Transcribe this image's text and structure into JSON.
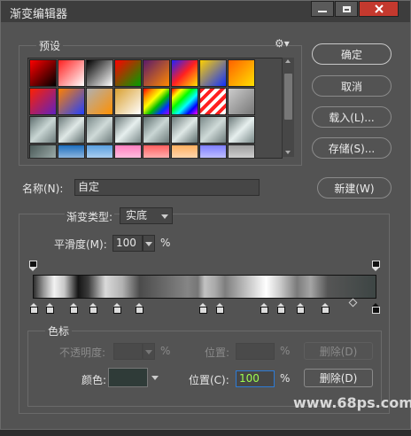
{
  "window": {
    "title": "渐变编辑器"
  },
  "presets": {
    "label": "预设",
    "gear_icon": "gear-icon",
    "swatch_rows": [
      [
        "linear-gradient(135deg,#ff0000,#000000)",
        "linear-gradient(135deg,#ff2020,#ffffff)",
        "linear-gradient(135deg,#000000,#ffffff)",
        "linear-gradient(135deg,#ff0000,#00a000)",
        "linear-gradient(135deg,#5a1a6a,#ff8800)",
        "linear-gradient(135deg,#2020ff,#ff2020,#ffe000)",
        "linear-gradient(135deg,#ffd000,#1030ff)",
        "linear-gradient(135deg,#ff6000,#ffe000)"
      ],
      [
        "linear-gradient(135deg,#ff2000,#6020c0)",
        "linear-gradient(135deg,#ff8000,#2040ff)",
        "linear-gradient(135deg,#b0b0b0,#ff9000)",
        "linear-gradient(135deg,#d9a030,#ffffff)",
        "linear-gradient(135deg,#ff0000,#ff9000,#ffff00,#00c000,#0030ff,#a000ff)",
        "linear-gradient(135deg,#ff0000,#ffff00,#00ff00,#00ffff,#0000ff,#ff00ff)",
        "repeating-linear-gradient(135deg,#ff2020 0 4px,#ffffff 4px 8px)",
        "linear-gradient(135deg,#cccccc,#777777)"
      ],
      [
        "linear-gradient(135deg,#5f6f6f,#c9d6d4,#6d7b7b)",
        "linear-gradient(135deg,#6d7b7b,#dfe8e6,#5f6f6f)",
        "linear-gradient(135deg,#7b8a8a,#cfdad8,#6d7b7b)",
        "linear-gradient(135deg,#6d7b7b,#e6efee,#7b8a8a)",
        "linear-gradient(135deg,#5f6f6f,#c9d6d4,#6d7b7b)",
        "linear-gradient(135deg,#6d7b7b,#dfe8e6,#5f6f6f)",
        "linear-gradient(135deg,#7b8a8a,#cfdad8,#6d7b7b)",
        "linear-gradient(135deg,#6d7b7b,#e6efee,#7b8a8a)"
      ],
      [
        "linear-gradient(135deg,#4a5a58,#b8c6c4)",
        "linear-gradient(180deg,#1e6fbf,#ffffff)",
        "linear-gradient(180deg,#5aa0e0,#ffffff)",
        "linear-gradient(180deg,#ff80c0,#ffffff)",
        "linear-gradient(180deg,#ff6060,#ffffff)",
        "linear-gradient(180deg,#ffb060,#ffffff)",
        "linear-gradient(180deg,#8080ff,#ffffff)",
        "linear-gradient(180deg,#a0a0a0,#ffffff)"
      ]
    ]
  },
  "buttons": {
    "ok": "确定",
    "cancel": "取消",
    "load": "载入(L)...",
    "save": "存储(S)...",
    "new": "新建(W)"
  },
  "name": {
    "label": "名称(N):",
    "value": "自定"
  },
  "gradient_type": {
    "label": "渐变类型:",
    "value": "实底"
  },
  "smoothness": {
    "label": "平滑度(M):",
    "value": "100",
    "unit": "%"
  },
  "color_stops_section": {
    "title": "色标",
    "opacity_label": "不透明度:",
    "opacity_unit": "%",
    "opacity_location_label": "位置:",
    "opacity_location_unit": "%",
    "opacity_delete": "删除(D)",
    "color_label": "颜色:",
    "color_value": "#2f3b38",
    "location_label": "位置(C):",
    "location_value": "100",
    "location_unit": "%",
    "color_delete": "删除(D)"
  },
  "watermark": "www.68ps.com"
}
